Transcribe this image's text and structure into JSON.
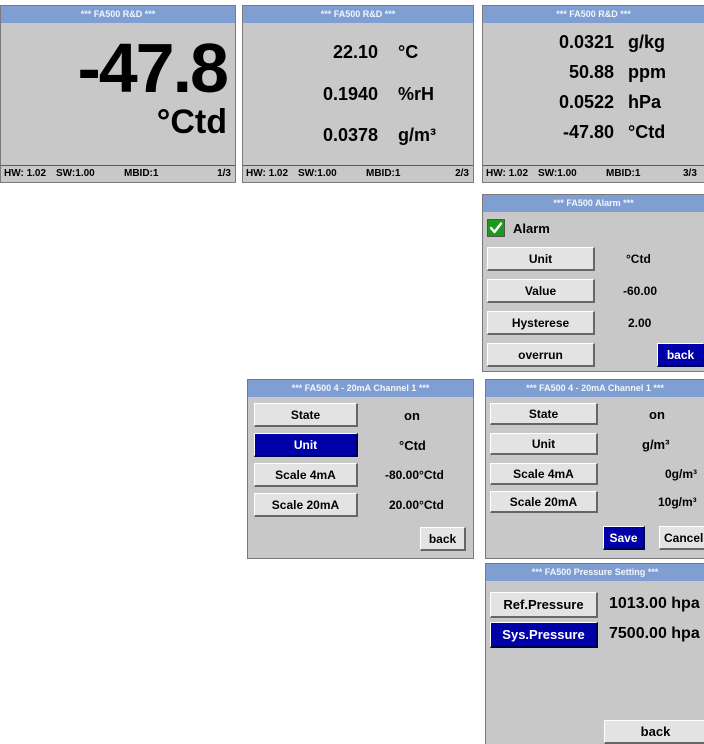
{
  "screen1": {
    "title": "*** FA500  R&D ***",
    "value": "-47.8",
    "unit": "°Ctd",
    "footer": {
      "hw": "HW: 1.02",
      "sw": "SW:1.00",
      "mbid": "MBID:1",
      "page": "1/3"
    }
  },
  "screen2": {
    "title": "*** FA500  R&D ***",
    "rows": [
      {
        "value": "22.10",
        "unit": "°C"
      },
      {
        "value": "0.1940",
        "unit": "%rH"
      },
      {
        "value": "0.0378",
        "unit": "g/m³"
      }
    ],
    "footer": {
      "hw": "HW: 1.02",
      "sw": "SW:1.00",
      "mbid": "MBID:1",
      "page": "2/3"
    }
  },
  "screen3": {
    "title": "*** FA500  R&D ***",
    "rows": [
      {
        "value": "0.0321",
        "unit": "g/kg"
      },
      {
        "value": "50.88",
        "unit": "ppm"
      },
      {
        "value": "0.0522",
        "unit": "hPa"
      },
      {
        "value": "-47.80",
        "unit": "°Ctd"
      }
    ],
    "footer": {
      "hw": "HW: 1.02",
      "sw": "SW:1.00",
      "mbid": "MBID:1",
      "page": "3/3"
    }
  },
  "alarm": {
    "title": "*** FA500  Alarm ***",
    "checkbox_label": "Alarm",
    "unit_label": "Unit",
    "unit_value": "°Ctd",
    "value_label": "Value",
    "value_value": "-60.00",
    "hysterese_label": "Hysterese",
    "hysterese_value": "2.00",
    "overrun_label": "overrun",
    "back_label": "back",
    "check_color": "#1a9a1a"
  },
  "channel_a": {
    "title": "*** FA500  4 - 20mA Channel 1 ***",
    "state_label": "State",
    "state_value": "on",
    "unit_label": "Unit",
    "unit_value": "°Ctd",
    "scale4_label": "Scale 4mA",
    "scale4_value": "-80.00°Ctd",
    "scale20_label": "Scale 20mA",
    "scale20_value": "20.00°Ctd",
    "back_label": "back"
  },
  "channel_b": {
    "title": "*** FA500  4 - 20mA Channel 1 ***",
    "state_label": "State",
    "state_value": "on",
    "unit_label": "Unit",
    "unit_value": "g/m³",
    "scale4_label": "Scale 4mA",
    "scale4_value": "0g/m³",
    "scale20_label": "Scale 20mA",
    "scale20_value": "10g/m³",
    "save_label": "Save",
    "cancel_label": "Cancel"
  },
  "pressure": {
    "title": "*** FA500  Pressure Setting ***",
    "ref_label": "Ref.Pressure",
    "ref_value": "1013.00 hpa",
    "sys_label": "Sys.Pressure",
    "sys_value": "7500.00 hpa",
    "back_label": "back"
  },
  "colors": {
    "titlebar": "#7f9fd3",
    "panel_bg": "#c8c8c8",
    "selected": "#0000a8"
  }
}
